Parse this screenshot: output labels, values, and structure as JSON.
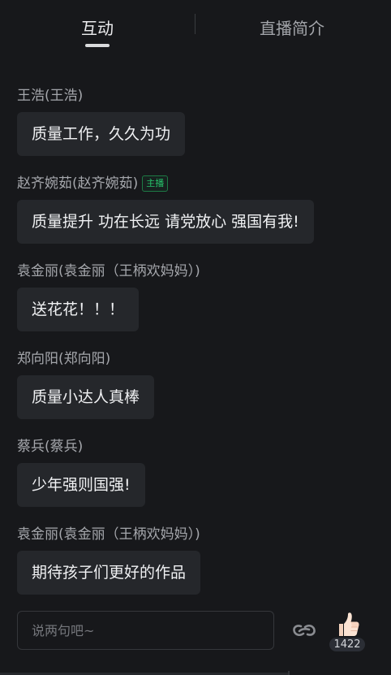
{
  "tabs": {
    "interact": "互动",
    "intro": "直播简介"
  },
  "messages": [
    {
      "sender": "王浩(王浩)",
      "text": "质量工作，久久为功",
      "badge": ""
    },
    {
      "sender": "赵齐婉茹(赵齐婉茹)",
      "text": "质量提升 功在长远 请党放心 强国有我!",
      "badge": "主播"
    },
    {
      "sender": "袁金丽(袁金丽（王柄欢妈妈）)",
      "text": "送花花！！！",
      "badge": ""
    },
    {
      "sender": "郑向阳(郑向阳)",
      "text": "质量小达人真棒",
      "badge": ""
    },
    {
      "sender": "蔡兵(蔡兵)",
      "text": "少年强则国强!",
      "badge": ""
    },
    {
      "sender": "袁金丽(袁金丽（王柄欢妈妈）)",
      "text": "期待孩子们更好的作品",
      "badge": ""
    }
  ],
  "input": {
    "placeholder": "说两句吧~"
  },
  "like": {
    "count": "1422"
  },
  "icons": {
    "link": "link-icon",
    "like": "thumbs-up-icon"
  },
  "colors": {
    "background": "#17181b",
    "bubble": "#25272b",
    "badge_green": "#27c26a"
  }
}
